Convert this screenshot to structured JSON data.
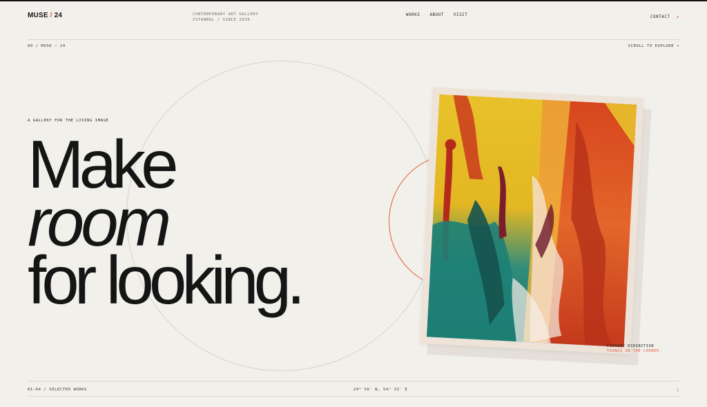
{
  "header": {
    "logo_main": "MUSE",
    "logo_sep": " / ",
    "logo_num": "24",
    "tagline_line1": "CONTEMPORARY ART GALLERY",
    "tagline_line2": "ISTANBUL / SINCE 2026",
    "nav": [
      "WORKS",
      "ABOUT",
      "VISIT"
    ],
    "contact_label": "CONTACT",
    "contact_icon": "arrow-up-right-icon"
  },
  "subheader": {
    "left": "00 / MUSE — 24",
    "right": "SCROLL TO EXPLORE →"
  },
  "hero": {
    "eyebrow": "A GALLERY FOR THE LIVING IMAGE",
    "line1": "Make",
    "line2": "room",
    "line3": "for looking."
  },
  "exhibition": {
    "label": "CURRENT EXHIBITION",
    "title": "THINGS IN THE CORNER."
  },
  "footer": {
    "left": "01—04 / SELECTED WORKS",
    "center": "24° 56′ N, 54° 33′ E",
    "arrow_icon": "arrow-down-icon",
    "arrow": "↓"
  },
  "colors": {
    "background": "#f2f0eb",
    "accent": "#e5553a",
    "ink": "#151515"
  }
}
